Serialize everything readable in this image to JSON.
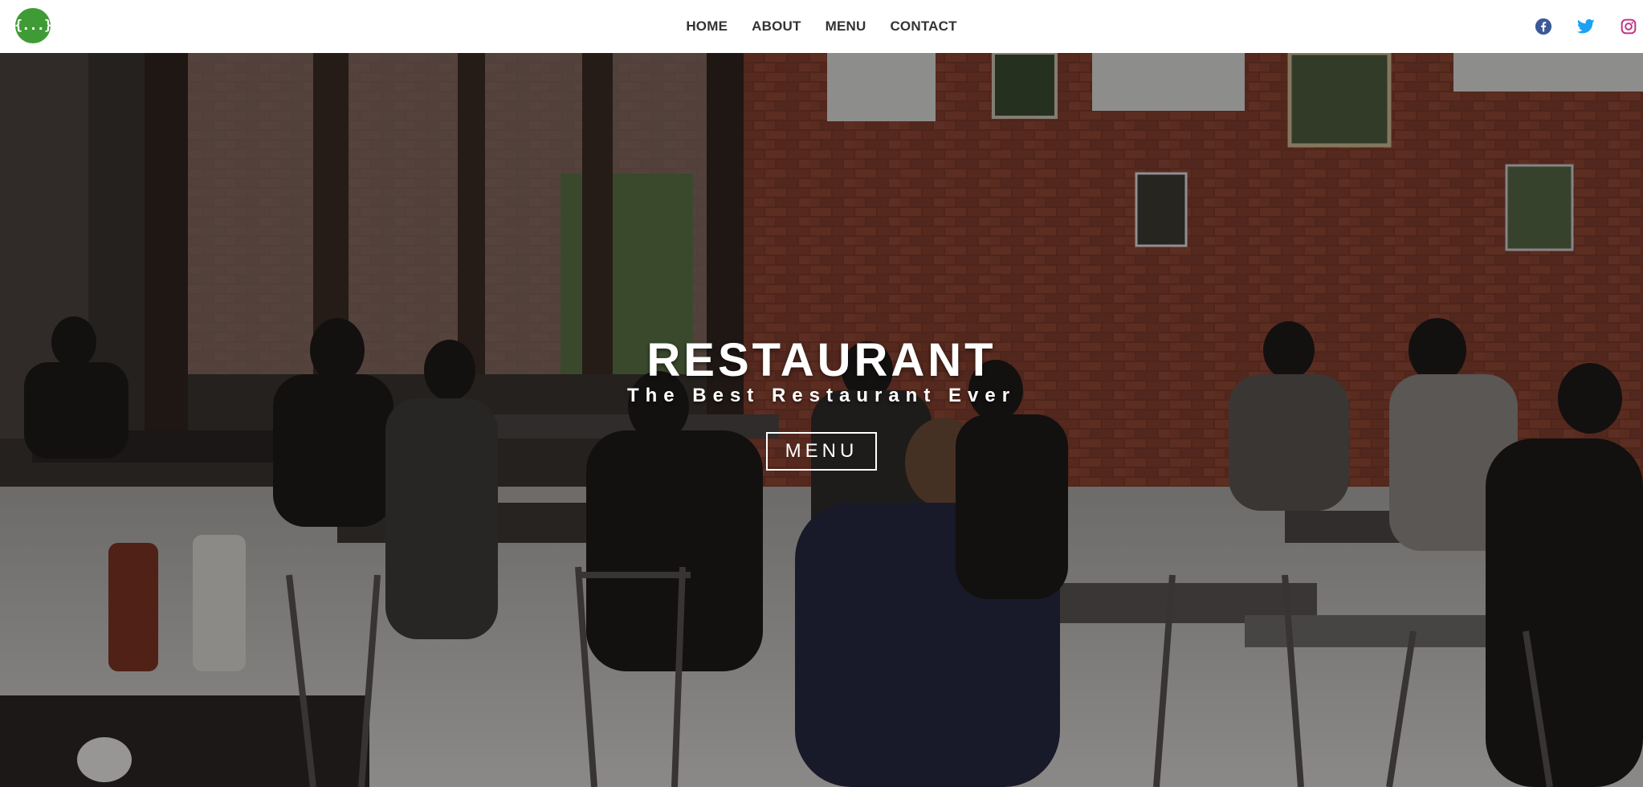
{
  "header": {
    "logo_text": "{...}",
    "nav": [
      {
        "label": "HOME"
      },
      {
        "label": "ABOUT"
      },
      {
        "label": "MENU"
      },
      {
        "label": "CONTACT"
      }
    ],
    "social": [
      {
        "icon": "facebook-icon",
        "color": "#3b5998"
      },
      {
        "icon": "twitter-icon",
        "color": "#1da1f2"
      },
      {
        "icon": "instagram-icon",
        "color": "#c13584"
      }
    ]
  },
  "hero": {
    "title": "RESTAURANT",
    "subtitle": "The Best Restaurant Ever",
    "button_label": "MENU"
  },
  "colors": {
    "logo": "#3f9b35",
    "nav_text": "#333333"
  }
}
